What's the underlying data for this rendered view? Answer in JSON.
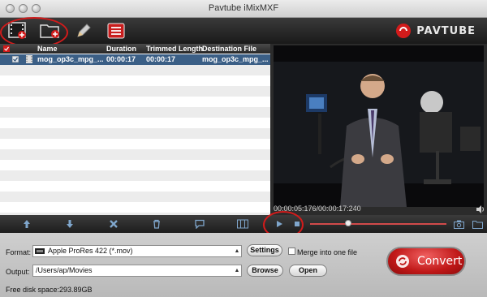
{
  "window": {
    "title": "Pavtube iMixMXF"
  },
  "toolbar": {
    "buttons": [
      {
        "name": "add-video",
        "icon": "film-add-icon"
      },
      {
        "name": "add-folder",
        "icon": "folder-add-icon"
      },
      {
        "name": "edit",
        "icon": "pencil-icon"
      },
      {
        "name": "task-list",
        "icon": "list-icon"
      }
    ],
    "brand": "PAVTUBE",
    "accent": "#d21b1b"
  },
  "file_list": {
    "columns": [
      "Name",
      "Duration",
      "Trimmed Length",
      "Destination File"
    ],
    "rows": [
      {
        "name": "mog_op3c_mpg_...",
        "duration": "00:00:17",
        "trimmed": "00:00:17",
        "destination": "mog_op3c_mpg_..."
      }
    ]
  },
  "preview": {
    "timecode": "00:00:05:176/00:00:17:240",
    "progress": 0.28
  },
  "bottom": {
    "format_label": "Format:",
    "format_value": "Apple ProRes 422 (*.mov)",
    "settings_label": "Settings",
    "merge_label": "Merge into one file",
    "output_label": "Output:",
    "output_value": "/Users/ap/Movies",
    "browse_label": "Browse",
    "open_label": "Open",
    "disk_space": "Free disk space:293.89GB",
    "convert_label": "Convert"
  }
}
